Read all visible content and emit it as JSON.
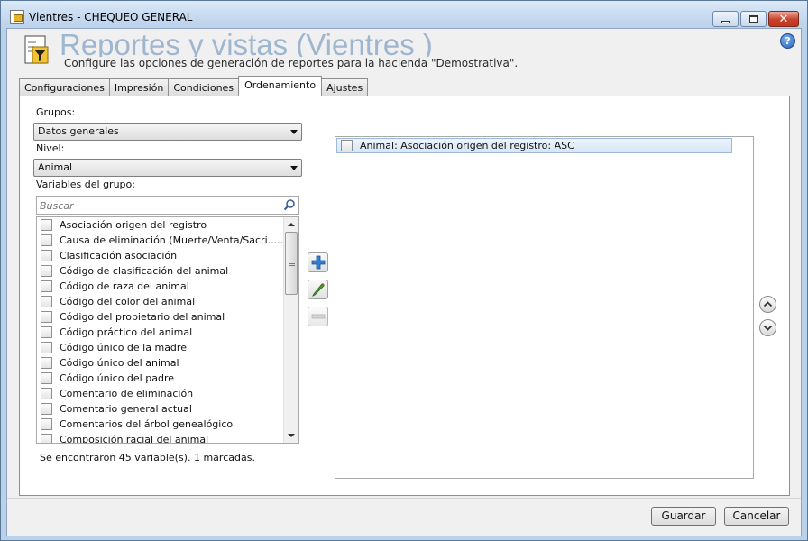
{
  "window": {
    "title": "Vientres  - CHEQUEO GENERAL"
  },
  "header": {
    "title": "Reportes y vistas (Vientres )",
    "subtitle": "Configure las opciones de generación de reportes para la hacienda \"Demostrativa\".",
    "help_label": "?"
  },
  "tabs": [
    {
      "label": "Configuraciones",
      "active": false
    },
    {
      "label": "Impresión",
      "active": false
    },
    {
      "label": "Condiciones",
      "active": false
    },
    {
      "label": "Ordenamiento",
      "active": true
    },
    {
      "label": "Ajustes",
      "active": false
    }
  ],
  "ordering": {
    "groups_label": "Grupos:",
    "groups_value": "Datos generales",
    "level_label": "Nivel:",
    "level_value": "Animal",
    "variables_label": "Variables del grupo:",
    "search_placeholder": "Buscar",
    "variables": [
      "Asociación origen del registro",
      "Causa de eliminación (Muerte/Venta/Sacri.....)",
      "Clasificación asociación",
      "Código de clasificación del animal",
      "Código de raza del animal",
      "Código del color del animal",
      "Código del propietario del animal",
      "Código práctico del animal",
      "Código único de la madre",
      "Código único del animal",
      "Código único del padre",
      "Comentario de eliminación",
      "Comentario general actual",
      "Comentarios del árbol genealógico",
      "Composición racial del animal"
    ],
    "status_text": "Se encontraron 45 variable(s). 1 marcadas.",
    "selected": [
      "Animal: Asociación origen del registro: ASC"
    ]
  },
  "footer": {
    "save_label": "Guardar",
    "cancel_label": "Cancelar"
  },
  "icons": {
    "add": "plus-icon",
    "edit": "pencil-icon",
    "remove": "minus-icon",
    "move_up": "chevron-up-icon",
    "move_down": "chevron-down-icon",
    "search": "search-icon"
  },
  "colors": {
    "title_bar": "#c4d8ef",
    "selection": "#d8e6f6",
    "add_button": "#2f7fd6",
    "edit_button": "#4aa02c"
  }
}
